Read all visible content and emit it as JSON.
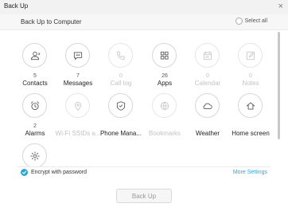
{
  "window": {
    "title": "Back Up",
    "close_glyph": "×"
  },
  "header": {
    "title": "Back Up to Computer",
    "select_all_label": "Select all"
  },
  "items": [
    {
      "key": "contacts",
      "icon": "person-icon",
      "count": "5",
      "label": "Contacts",
      "enabled": true
    },
    {
      "key": "messages",
      "icon": "chat-bubble-icon",
      "count": "7",
      "label": "Messages",
      "enabled": true
    },
    {
      "key": "call-log",
      "icon": "phone-icon",
      "count": "0",
      "label": "Call log",
      "enabled": false
    },
    {
      "key": "apps",
      "icon": "grid-icon",
      "count": "26",
      "label": "Apps",
      "enabled": true
    },
    {
      "key": "calendar",
      "icon": "calendar-icon",
      "count": "0",
      "label": "Calendar",
      "enabled": false
    },
    {
      "key": "notes",
      "icon": "note-icon",
      "count": "0",
      "label": "Notes",
      "enabled": false
    },
    {
      "key": "alarms",
      "icon": "alarm-clock-icon",
      "count": "2",
      "label": "Alarms",
      "enabled": true
    },
    {
      "key": "wifi-ssids",
      "icon": "wifi-pin-icon",
      "count": "",
      "label": "Wi-Fi SSIDs a...",
      "enabled": false
    },
    {
      "key": "phone-manager",
      "icon": "shield-icon",
      "count": "",
      "label": "Phone Mana...",
      "enabled": true
    },
    {
      "key": "bookmarks",
      "icon": "globe-icon",
      "count": "",
      "label": "Bookmarks",
      "enabled": false
    },
    {
      "key": "weather",
      "icon": "cloud-icon",
      "count": "",
      "label": "Weather",
      "enabled": true
    },
    {
      "key": "home-screen",
      "icon": "home-icon",
      "count": "",
      "label": "Home screen",
      "enabled": true
    },
    {
      "key": "other",
      "icon": "gear-icon",
      "count": "",
      "label": "",
      "enabled": true
    }
  ],
  "footer": {
    "encrypt_label": "Encrypt with password",
    "encrypt_checked": true,
    "more_settings_label": "More Settings",
    "backup_button_label": "Back Up"
  },
  "colors": {
    "accent": "#2aa5d8",
    "disabled_text": "#c2c2c2",
    "icon_stroke": "#555555"
  }
}
